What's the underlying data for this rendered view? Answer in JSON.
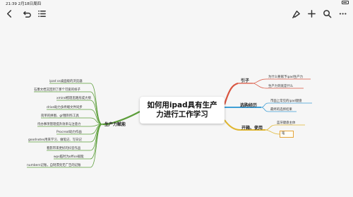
{
  "status_bar": {
    "time_date": "21:39  2月18日周四"
  },
  "toolbar": {
    "left": [
      "back-icon",
      "undo-icon",
      "outline-list-icon"
    ],
    "right": [
      "format-brush-icon",
      "add-icon",
      "search-icon",
      "more-icon"
    ]
  },
  "map": {
    "center": "如何用ipad具有生产力进行工作学习",
    "branches": {
      "intro": {
        "title": "引子",
        "color": "#d9543f",
        "children": [
          "为什么要赋予ipad生产力",
          "生产力到底是什么"
        ]
      },
      "selection": {
        "title": "选购经历",
        "color": "#3f9fd6",
        "children": [
          "市面上常见的ipad键盘",
          "最终的选择结果"
        ]
      },
      "start": {
        "title": "开箱、使用",
        "color": "#e0b732",
        "children": [
          "蓝牙键盘主体",
          "笔"
        ]
      },
      "productivity": {
        "title": "生产力赋能",
        "color": "#5c9e3a",
        "children": [
          "ipad os桌面级的浏览器",
          "石墨文档又回到了那个可爱的样子",
          "xmind梳理思路形成大纲",
          "drive助力多终端文件同步",
          "简单的拼图、gif图制作工具",
          "待办事项管理提升效率与注意力",
          "Procreat助力作画",
          "goodnotes用来学习、做笔记、写日记",
          "看影带来更好的抖音作品",
          "wps临时为office赋能",
          "numbers记账，自制漂亮无广告的记账"
        ]
      }
    }
  }
}
